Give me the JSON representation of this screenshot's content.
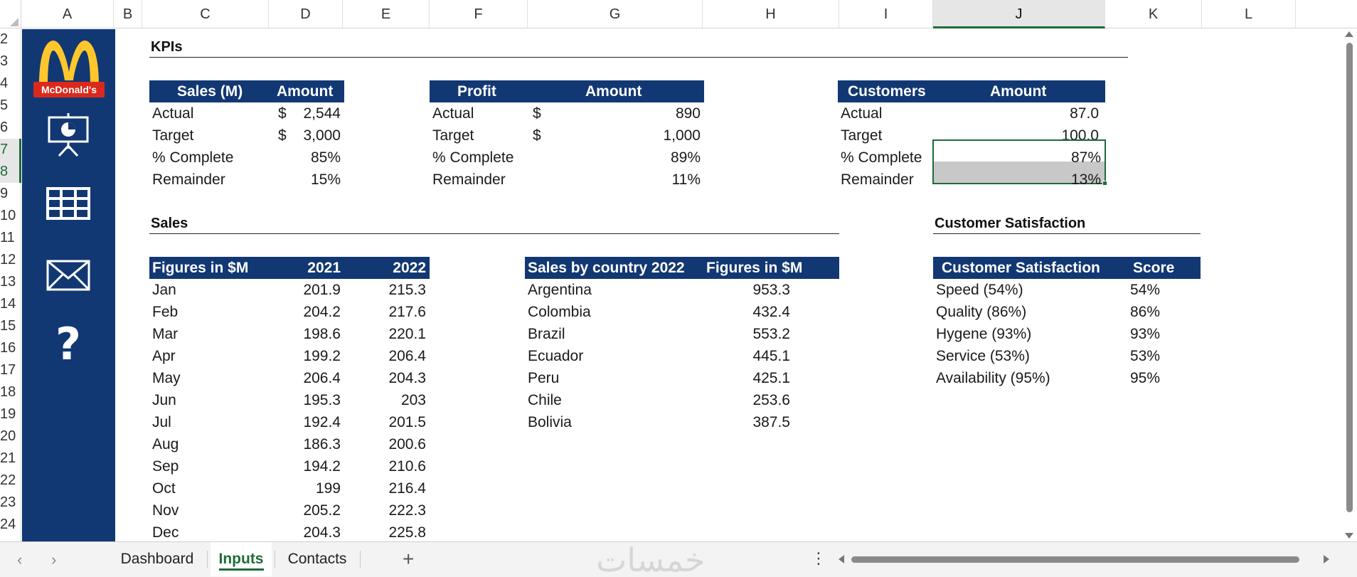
{
  "columns": [
    "A",
    "B",
    "C",
    "D",
    "E",
    "F",
    "G",
    "H",
    "I",
    "J",
    "K",
    "L"
  ],
  "selected_column": "J",
  "rows": [
    "2",
    "3",
    "4",
    "5",
    "6",
    "7",
    "8",
    "9",
    "10",
    "11",
    "12",
    "13",
    "14",
    "15",
    "16",
    "17",
    "18",
    "19",
    "20",
    "21",
    "22",
    "23",
    "24"
  ],
  "selected_rows": [
    "7",
    "8"
  ],
  "logo_text": "McDonald's",
  "sidebar_icons": [
    "presentation-icon",
    "table-grid-icon",
    "mail-icon",
    "help-icon"
  ],
  "kpis": {
    "title": "KPIs",
    "sales": {
      "header": [
        "Sales (M)",
        "Amount"
      ],
      "rows": [
        {
          "label": "Actual",
          "currency": "$",
          "value": "2,544"
        },
        {
          "label": "Target",
          "currency": "$",
          "value": "3,000"
        },
        {
          "label": "% Complete",
          "currency": "",
          "value": "85%"
        },
        {
          "label": "Remainder",
          "currency": "",
          "value": "15%"
        }
      ]
    },
    "profit": {
      "header": [
        "Profit",
        "Amount"
      ],
      "rows": [
        {
          "label": "Actual",
          "currency": "$",
          "value": "890"
        },
        {
          "label": "Target",
          "currency": "$",
          "value": "1,000"
        },
        {
          "label": "% Complete",
          "currency": "",
          "value": "89%"
        },
        {
          "label": "Remainder",
          "currency": "",
          "value": "11%"
        }
      ]
    },
    "customers": {
      "header": [
        "Customers",
        "Amount"
      ],
      "rows": [
        {
          "label": "Actual",
          "value": "87.0"
        },
        {
          "label": "Target",
          "value": "100.0"
        },
        {
          "label": "% Complete",
          "value": "87%"
        },
        {
          "label": "Remainder",
          "value": "13%"
        }
      ]
    }
  },
  "sales": {
    "title": "Sales",
    "monthly": {
      "header": [
        "Figures in $M",
        "2021",
        "2022"
      ],
      "rows": [
        [
          "Jan",
          "201.9",
          "215.3"
        ],
        [
          "Feb",
          "204.2",
          "217.6"
        ],
        [
          "Mar",
          "198.6",
          "220.1"
        ],
        [
          "Apr",
          "199.2",
          "206.4"
        ],
        [
          "May",
          "206.4",
          "204.3"
        ],
        [
          "Jun",
          "195.3",
          "203"
        ],
        [
          "Jul",
          "192.4",
          "201.5"
        ],
        [
          "Aug",
          "186.3",
          "200.6"
        ],
        [
          "Sep",
          "194.2",
          "210.6"
        ],
        [
          "Oct",
          "199",
          "216.4"
        ],
        [
          "Nov",
          "205.2",
          "222.3"
        ],
        [
          "Dec",
          "204.3",
          "225.8"
        ]
      ]
    },
    "by_country": {
      "header": [
        "Sales by country 2022",
        "Figures in $M"
      ],
      "rows": [
        [
          "Argentina",
          "953.3"
        ],
        [
          "Colombia",
          "432.4"
        ],
        [
          "Brazil",
          "553.2"
        ],
        [
          "Ecuador",
          "445.1"
        ],
        [
          "Peru",
          "425.1"
        ],
        [
          "Chile",
          "253.6"
        ],
        [
          "Bolivia",
          "387.5"
        ]
      ]
    }
  },
  "satisfaction": {
    "title": "Customer Satisfaction",
    "header": [
      "Customer Satisfaction",
      "Score"
    ],
    "rows": [
      [
        "Speed (54%)",
        "54%"
      ],
      [
        "Quality (86%)",
        "86%"
      ],
      [
        "Hygene (93%)",
        "93%"
      ],
      [
        "Service (53%)",
        "53%"
      ],
      [
        "Availability (95%)",
        "95%"
      ]
    ]
  },
  "tabs": [
    {
      "label": "Dashboard",
      "active": false
    },
    {
      "label": "Inputs",
      "active": true
    },
    {
      "label": "Contacts",
      "active": false
    }
  ],
  "tab_nav": {
    "prev": "‹",
    "next": "›",
    "add": "+",
    "more": "⋮"
  },
  "watermark": "خمسات",
  "colors": {
    "navy": "#123873",
    "selection": "#1f6b3a",
    "brand_red": "#da291c",
    "brand_yellow": "#ffc72c"
  }
}
